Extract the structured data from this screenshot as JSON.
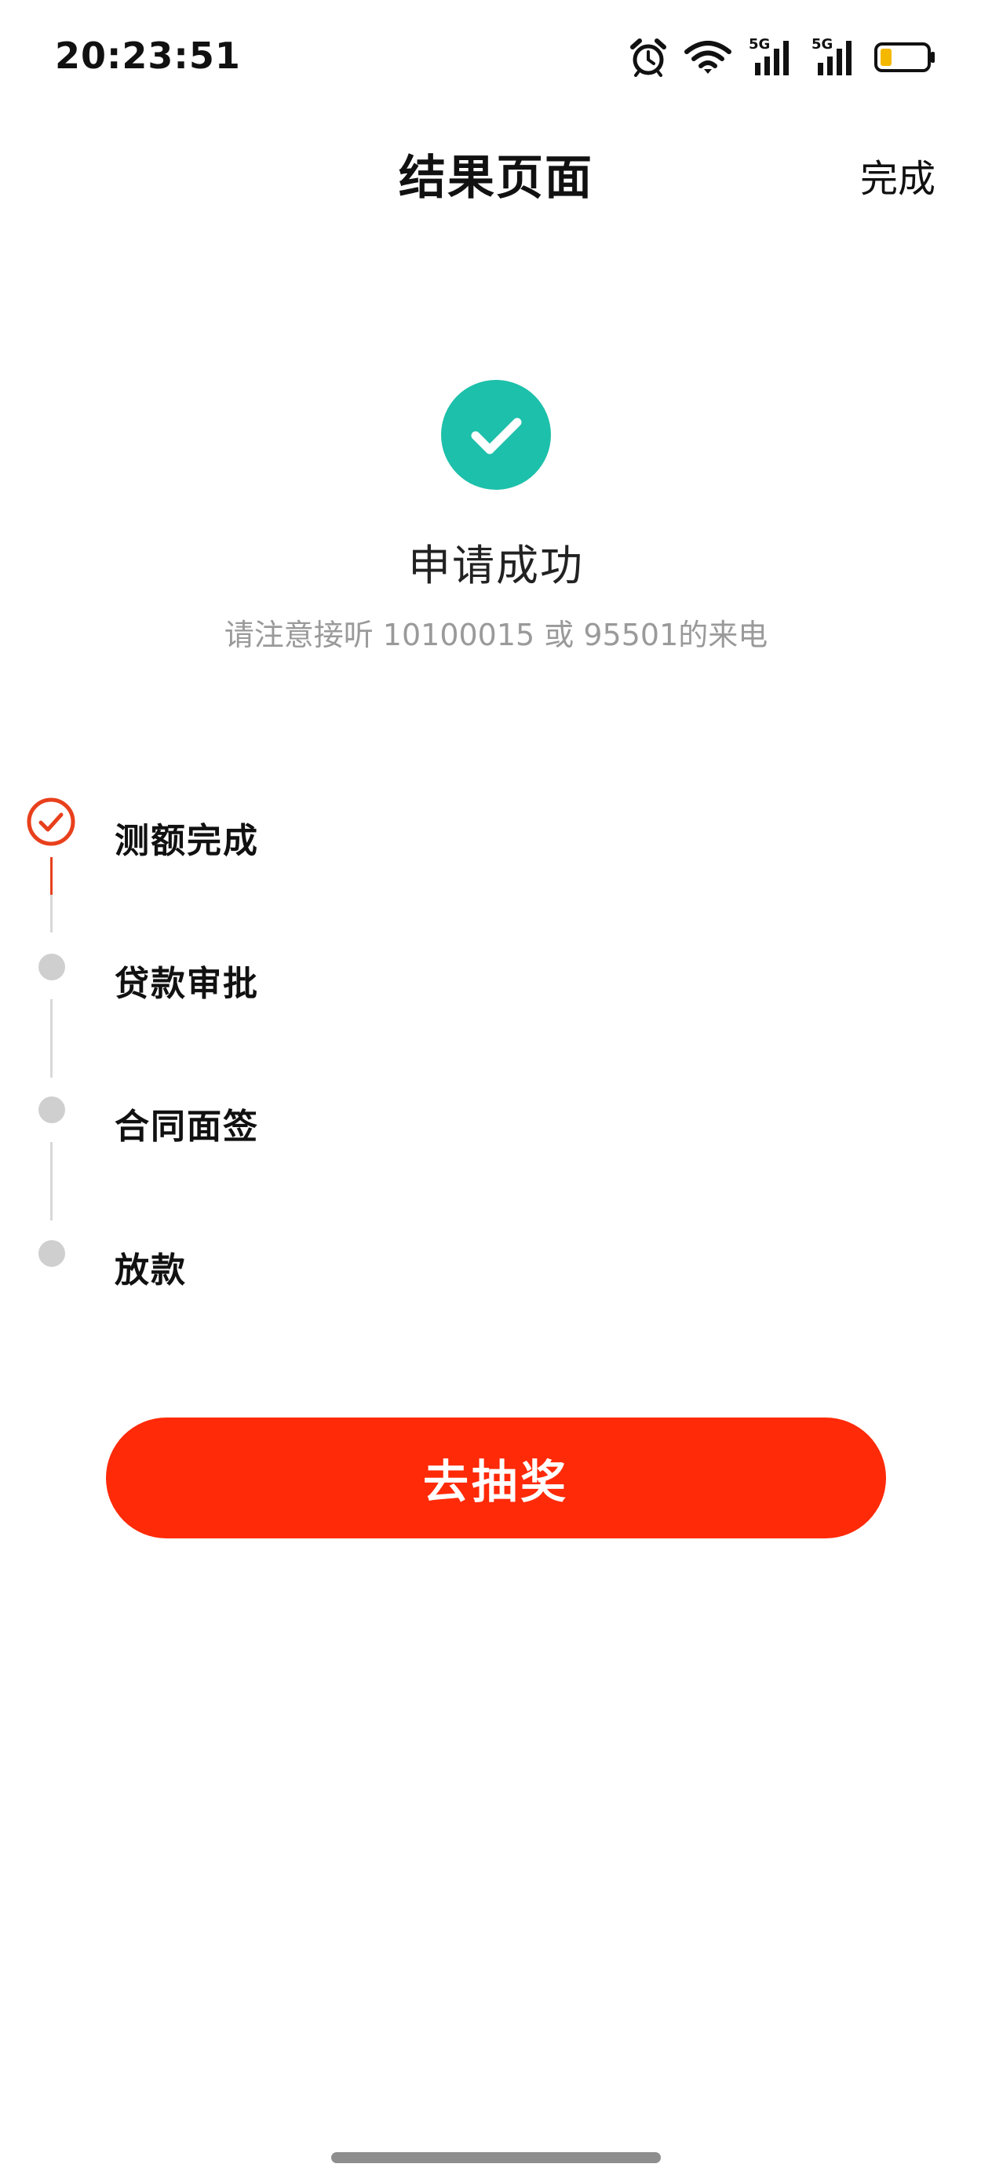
{
  "status_bar": {
    "time": "20:23:51",
    "network_1_label": "5G",
    "network_2_label": "5G",
    "battery_color": "#f5b800"
  },
  "nav": {
    "title": "结果页面",
    "done_label": "完成"
  },
  "result": {
    "title": "申请成功",
    "subtitle": "请注意接听 10100015 或 95501的来电",
    "accent_color": "#1dc0aa"
  },
  "steps": [
    {
      "label": "测额完成",
      "status": "done"
    },
    {
      "label": "贷款审批",
      "status": "pending"
    },
    {
      "label": "合同面签",
      "status": "pending"
    },
    {
      "label": "放款",
      "status": "pending"
    }
  ],
  "step_colors": {
    "done": "#e8401c",
    "pending": "#cfcfcf"
  },
  "primary_button": {
    "label": "去抽奖",
    "color": "#ff2a08"
  }
}
